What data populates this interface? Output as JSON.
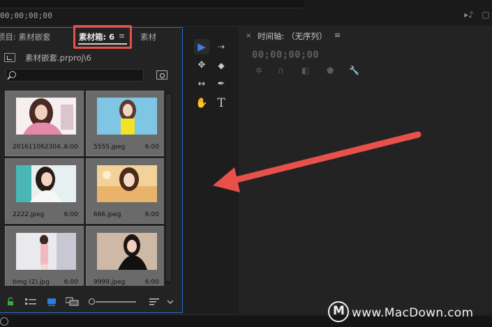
{
  "top_bar": {
    "timecode": "00;00;00;00",
    "icons": [
      "mark-in-icon",
      "export-frame-icon"
    ]
  },
  "project_panel": {
    "tabs": [
      {
        "label": "项目: 素材嵌套",
        "active": false
      },
      {
        "label": "素材箱: 6",
        "active": true
      },
      {
        "label": "素材",
        "active": false
      }
    ],
    "menu_glyph": "≡",
    "path": "素材嵌套.prproj\\6",
    "search": {
      "value": "",
      "placeholder": ""
    },
    "items": [
      {
        "name": "201611062304...",
        "duration": "6:00",
        "thumb": "portrait-pink"
      },
      {
        "name": "5555.jpeg",
        "duration": "6:00",
        "thumb": "portrait-blue-yellow"
      },
      {
        "name": "2222.jpeg",
        "duration": "6:00",
        "thumb": "portrait-teal"
      },
      {
        "name": "666.jpeg",
        "duration": "6:00",
        "thumb": "portrait-warm"
      },
      {
        "name": "timg (2).jpg",
        "duration": "6:00",
        "thumb": "portrait-full-pink"
      },
      {
        "name": "9999.jpeg",
        "duration": "6:00",
        "thumb": "portrait-dark"
      }
    ],
    "footer_icons": [
      "lock-icon",
      "list-view-icon",
      "icon-view-icon",
      "freeform-view-icon",
      "zoom-slider",
      "sort-icon",
      "chevron-down-icon"
    ]
  },
  "tools": [
    {
      "name": "selection-tool",
      "glyph": "▶",
      "selected": true
    },
    {
      "name": "track-select-tool",
      "glyph": "⇢",
      "selected": false
    },
    {
      "name": "ripple-edit-tool",
      "glyph": "✥",
      "selected": false
    },
    {
      "name": "razor-tool",
      "glyph": "◆",
      "selected": false
    },
    {
      "name": "slip-tool",
      "glyph": "↔",
      "selected": false
    },
    {
      "name": "pen-tool",
      "glyph": "✒",
      "selected": false
    },
    {
      "name": "hand-tool",
      "glyph": "✋",
      "selected": false
    },
    {
      "name": "type-tool",
      "glyph": "T",
      "selected": false
    }
  ],
  "timeline": {
    "close_glyph": "×",
    "title": "时间轴: （无序列）",
    "menu_glyph": "≡",
    "timecode": "00;00;00;00"
  },
  "watermark": {
    "text": "www.MacDown.com"
  },
  "colors": {
    "annotation": "#e8504a",
    "panel_focus": "#2d6dd0",
    "accent": "#3e7ee8"
  }
}
